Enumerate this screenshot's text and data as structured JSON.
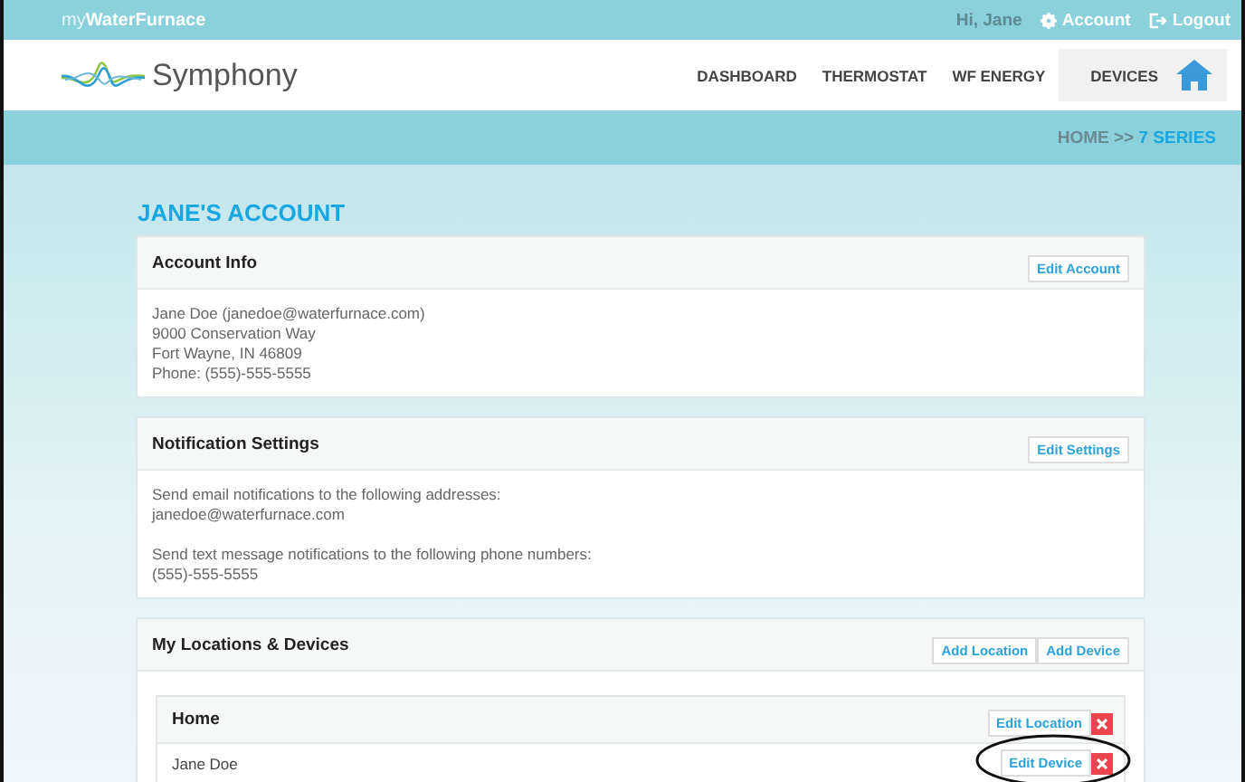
{
  "topbar": {
    "brand_prefix": "my",
    "brand": "WaterFurnace",
    "greeting": "Hi, Jane",
    "account_link": "Account",
    "logout_link": "Logout"
  },
  "header": {
    "logo_text": "Symphony",
    "nav": [
      {
        "label": "DASHBOARD",
        "selected": false
      },
      {
        "label": "THERMOSTAT",
        "selected": false
      },
      {
        "label": "WF ENERGY",
        "selected": false
      },
      {
        "label": "DEVICES",
        "selected": true
      }
    ]
  },
  "breadcrumb": {
    "home": "HOME",
    "separator": ">>",
    "current": "7 SERIES"
  },
  "page_title": "JANE'S ACCOUNT",
  "account_info": {
    "title": "Account Info",
    "button": "Edit Account",
    "lines": [
      "Jane Doe (janedoe@waterfurnace.com)",
      "9000 Conservation Way",
      "Fort Wayne, IN 46809",
      "Phone: (555)-555-5555"
    ]
  },
  "notification_settings": {
    "title": "Notification Settings",
    "button": "Edit Settings",
    "groups": [
      {
        "label": "Send email notifications to the following addresses:",
        "value": "janedoe@waterfurnace.com"
      },
      {
        "label": "Send text message notifications to the following phone numbers:",
        "value": "(555)-555-5555"
      }
    ]
  },
  "locations": {
    "title": "My Locations & Devices",
    "buttons": [
      "Add Location",
      "Add Device"
    ],
    "items": [
      {
        "name": "Home",
        "button": "Edit Location",
        "devices": [
          {
            "name": "Jane Doe",
            "button": "Edit Device",
            "circled": true
          }
        ]
      }
    ]
  }
}
